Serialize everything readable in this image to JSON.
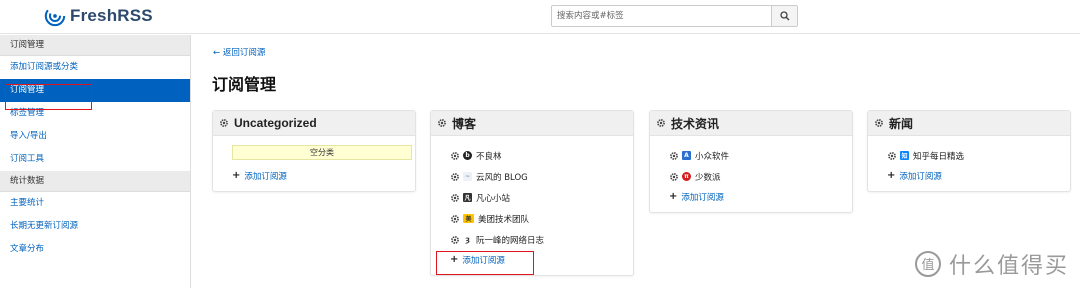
{
  "header": {
    "brand": "FreshRSS",
    "search_placeholder": "搜索内容或#标签"
  },
  "sidebar": {
    "section_manage": "订阅管理",
    "items_manage": [
      {
        "label": "添加订阅源或分类",
        "active": false
      },
      {
        "label": "订阅管理",
        "active": true
      },
      {
        "label": "标签管理",
        "active": false
      },
      {
        "label": "导入/导出",
        "active": false
      },
      {
        "label": "订阅工具",
        "active": false
      }
    ],
    "section_stats": "统计数据",
    "items_stats": [
      {
        "label": "主要统计"
      },
      {
        "label": "长期无更新订阅源"
      },
      {
        "label": "文章分布"
      }
    ]
  },
  "main": {
    "back_link": "← 返回订阅源",
    "title": "订阅管理",
    "add_feed_label": "添加订阅源",
    "categories": [
      {
        "name": "Uncategorized",
        "empty_label": "空分类",
        "feeds": []
      },
      {
        "name": "博客",
        "feeds": [
          {
            "name": "不良林",
            "icon": "buliang-favicon"
          },
          {
            "name": "云风的 BLOG",
            "icon": "yunfeng-favicon"
          },
          {
            "name": "凡心小站",
            "icon": "fanxin-favicon"
          },
          {
            "name": "美团技术团队",
            "icon": "meituan-favicon"
          },
          {
            "name": "阮一峰的网络日志",
            "icon": "ruanyifeng-favicon"
          }
        ]
      },
      {
        "name": "技术资讯",
        "feeds": [
          {
            "name": "小众软件",
            "icon": "appinn-favicon"
          },
          {
            "name": "少数派",
            "icon": "sspai-favicon"
          }
        ]
      },
      {
        "name": "新闻",
        "feeds": [
          {
            "name": "知乎每日精选",
            "icon": "zhihu-favicon"
          }
        ]
      }
    ]
  },
  "watermark": {
    "text": "什么值得买"
  },
  "colors": {
    "accent": "#0062be",
    "highlight_box": "#e0141e",
    "empty_bg": "#ffffd3"
  }
}
